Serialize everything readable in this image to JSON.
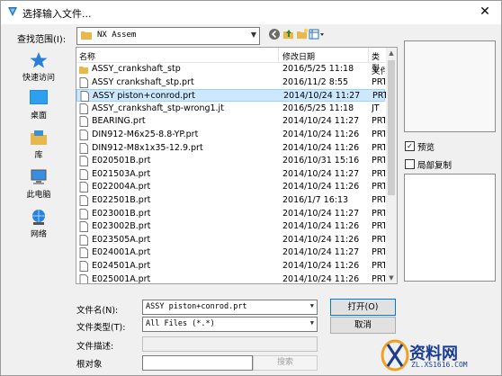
{
  "window": {
    "title": "选择输入文件...",
    "close_glyph": "✕"
  },
  "lookin": {
    "label": "查找范围(I):",
    "value": "NX Assem"
  },
  "places": [
    {
      "label": "快速访问",
      "icon": "star-icon"
    },
    {
      "label": "桌面",
      "icon": "desktop-icon"
    },
    {
      "label": "库",
      "icon": "library-icon"
    },
    {
      "label": "此电脑",
      "icon": "computer-icon"
    },
    {
      "label": "网络",
      "icon": "network-icon"
    }
  ],
  "columns": {
    "name": "名称",
    "date": "修改日期",
    "type": "类型"
  },
  "files": [
    {
      "name": "ASSY_crankshaft_stp",
      "date": "2016/5/25 11:18",
      "type": "文件",
      "kind": "folder"
    },
    {
      "name": "ASSY crankshaft_stp.prt",
      "date": "2016/11/2 8:55",
      "type": "PRT",
      "kind": "file"
    },
    {
      "name": "ASSY piston+conrod.prt",
      "date": "2014/10/24 11:27",
      "type": "PRT",
      "kind": "file",
      "selected": true
    },
    {
      "name": "ASSY_crankshaft_stp-wrong1.jt",
      "date": "2016/5/25 11:18",
      "type": "JT",
      "kind": "file"
    },
    {
      "name": "BEARING.prt",
      "date": "2014/10/24 11:27",
      "type": "PRT",
      "kind": "file"
    },
    {
      "name": "DIN912-M6x25-8.8-YP.prt",
      "date": "2014/10/24 11:26",
      "type": "PRT",
      "kind": "file"
    },
    {
      "name": "DIN912-M8x1x35-12.9.prt",
      "date": "2014/10/24 11:26",
      "type": "PRT",
      "kind": "file"
    },
    {
      "name": "E020501B.prt",
      "date": "2016/10/31 15:16",
      "type": "PRT",
      "kind": "file"
    },
    {
      "name": "E021503A.prt",
      "date": "2014/10/24 11:27",
      "type": "PRT",
      "kind": "file"
    },
    {
      "name": "E022004A.prt",
      "date": "2014/10/24 11:26",
      "type": "PRT",
      "kind": "file"
    },
    {
      "name": "E022501B.prt",
      "date": "2016/1/7 16:13",
      "type": "PRT",
      "kind": "file"
    },
    {
      "name": "E023001B.prt",
      "date": "2014/10/24 11:27",
      "type": "PRT",
      "kind": "file"
    },
    {
      "name": "E023002B.prt",
      "date": "2014/10/24 11:26",
      "type": "PRT",
      "kind": "file"
    },
    {
      "name": "E023505A.prt",
      "date": "2014/10/24 11:26",
      "type": "PRT",
      "kind": "file"
    },
    {
      "name": "E024001A.prt",
      "date": "2014/10/24 11:27",
      "type": "PRT",
      "kind": "file"
    },
    {
      "name": "E024501A.prt",
      "date": "2014/10/24 11:26",
      "type": "PRT",
      "kind": "file"
    },
    {
      "name": "E025001A.prt",
      "date": "2014/10/24 11:26",
      "type": "PRT",
      "kind": "file"
    }
  ],
  "options": {
    "preview": "预览",
    "preview_checked": true,
    "partial_copy": "局部复制",
    "partial_checked": false
  },
  "form": {
    "filename_label": "文件名(N):",
    "filename_value": "ASSY piston+conrod.prt",
    "filetype_label": "文件类型(T):",
    "filetype_value": "All Files (*.*)",
    "description_label": "文件描述:",
    "root_label": "根对象",
    "search_label": "搜索",
    "open_label": "打开(O)",
    "cancel_label": "取消"
  },
  "watermark": {
    "text": "资料网",
    "url": "ZL.XS1616.COM"
  },
  "colors": {
    "accent": "#0078d7",
    "selection": "#cce8ff",
    "folder": "#e8b84a"
  }
}
